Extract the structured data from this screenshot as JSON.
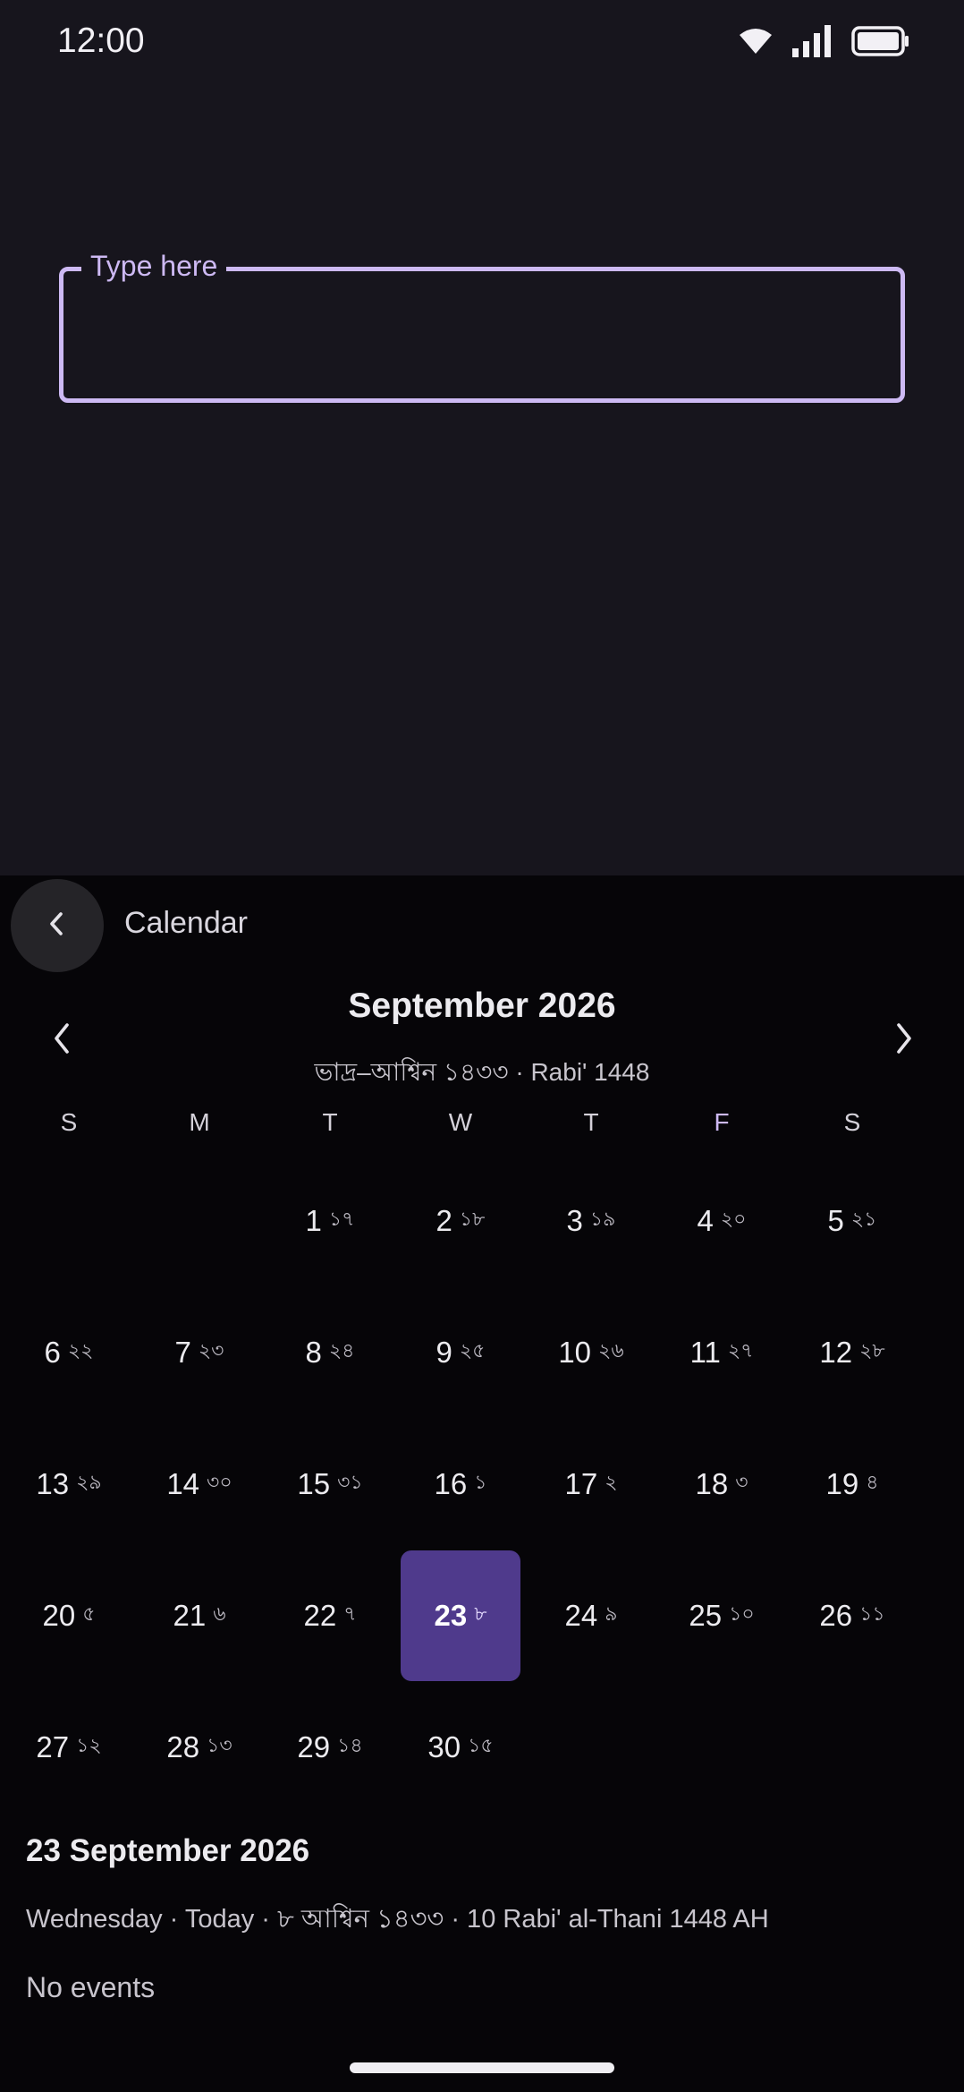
{
  "status_bar": {
    "time": "12:00",
    "icons": [
      "wifi-icon",
      "signal-icon",
      "battery-icon"
    ]
  },
  "text_field": {
    "label": "Type here",
    "value": ""
  },
  "sheet": {
    "title": "Calendar",
    "back_icon": "chevron-left-icon"
  },
  "calendar": {
    "month_title": "September 2026",
    "subtitle": "ভাদ্র–আশ্বিন ১৪৩৩  ·  Rabi' 1448",
    "prev_icon": "chevron-left-icon",
    "next_icon": "chevron-right-icon",
    "weekdays": [
      "S",
      "M",
      "T",
      "W",
      "T",
      "F",
      "S"
    ],
    "weeks": [
      [
        null,
        null,
        {
          "d": "1",
          "b": "১৭"
        },
        {
          "d": "2",
          "b": "১৮"
        },
        {
          "d": "3",
          "b": "১৯"
        },
        {
          "d": "4",
          "b": "২০"
        },
        {
          "d": "5",
          "b": "২১"
        }
      ],
      [
        {
          "d": "6",
          "b": "২২"
        },
        {
          "d": "7",
          "b": "২৩"
        },
        {
          "d": "8",
          "b": "২৪"
        },
        {
          "d": "9",
          "b": "২৫"
        },
        {
          "d": "10",
          "b": "২৬"
        },
        {
          "d": "11",
          "b": "২৭"
        },
        {
          "d": "12",
          "b": "২৮"
        }
      ],
      [
        {
          "d": "13",
          "b": "২৯"
        },
        {
          "d": "14",
          "b": "৩০"
        },
        {
          "d": "15",
          "b": "৩১"
        },
        {
          "d": "16",
          "b": "১"
        },
        {
          "d": "17",
          "b": "২"
        },
        {
          "d": "18",
          "b": "৩"
        },
        {
          "d": "19",
          "b": "৪"
        }
      ],
      [
        {
          "d": "20",
          "b": "৫"
        },
        {
          "d": "21",
          "b": "৬"
        },
        {
          "d": "22",
          "b": "৭"
        },
        {
          "d": "23",
          "b": "৮",
          "selected": true
        },
        {
          "d": "24",
          "b": "৯"
        },
        {
          "d": "25",
          "b": "১০"
        },
        {
          "d": "26",
          "b": "১১"
        }
      ],
      [
        {
          "d": "27",
          "b": "১২"
        },
        {
          "d": "28",
          "b": "১৩"
        },
        {
          "d": "29",
          "b": "১৪"
        },
        {
          "d": "30",
          "b": "১৫"
        },
        null,
        null,
        null
      ]
    ]
  },
  "selected_info": {
    "date": "23 September 2026",
    "detail": "Wednesday · Today · ৮ আশ্বিন ১৪৩৩ · 10 Rabi' al-Thani 1448 AH",
    "events": "No events"
  },
  "colors": {
    "accent": "#cdb9f3",
    "selected_day": "#4f3a8c",
    "top_background": "#17151d",
    "sheet_background": "#060508"
  }
}
